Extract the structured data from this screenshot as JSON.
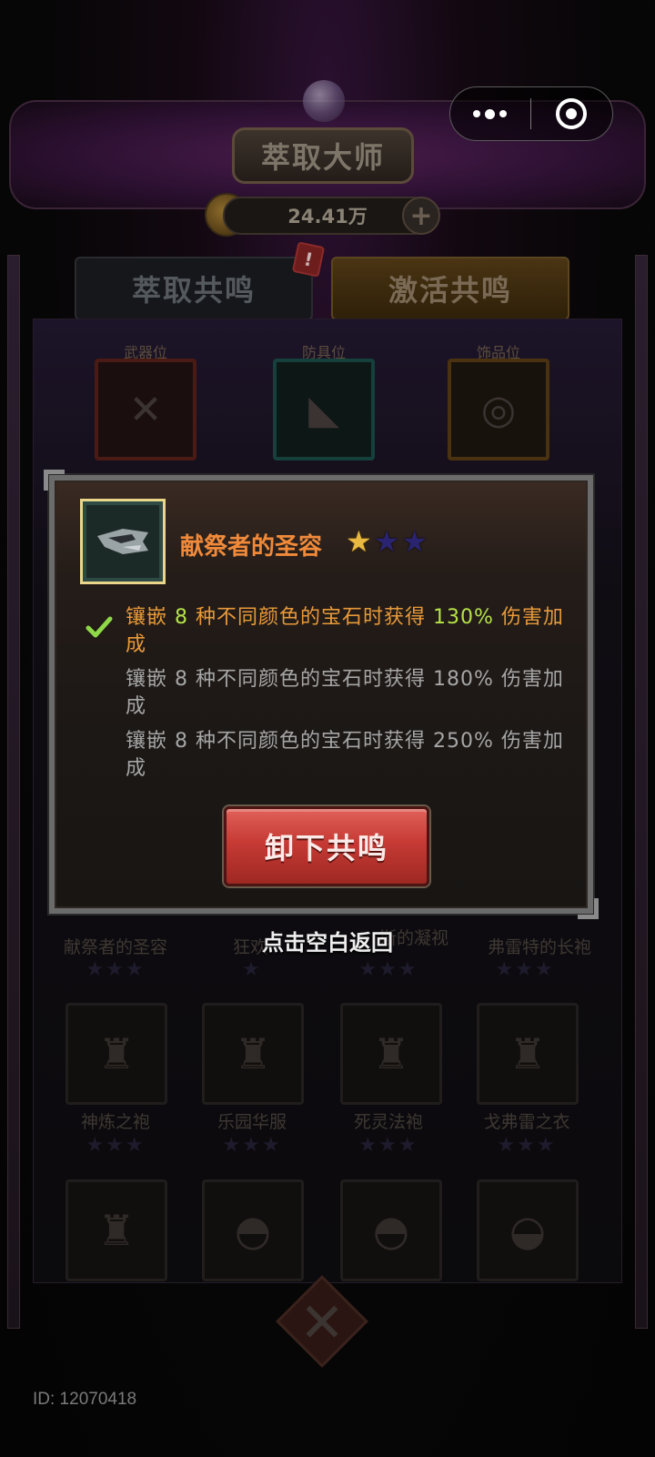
{
  "header": {
    "title": "萃取大师",
    "currency_amount": "24.41万"
  },
  "tabs": [
    {
      "label": "萃取共鸣"
    },
    {
      "label": "激活共鸣"
    }
  ],
  "alert_badge": "!",
  "slots": [
    {
      "label": "武器位"
    },
    {
      "label": "防具位"
    },
    {
      "label": "饰品位"
    }
  ],
  "grid": {
    "row1": [
      {
        "name": "献祭者的圣容"
      },
      {
        "name": "狂欢"
      },
      {
        "name": "斯的凝视"
      },
      {
        "name": "弗雷特的长袍"
      }
    ],
    "row2": [
      {
        "name": "神炼之袍"
      },
      {
        "name": "乐园华服"
      },
      {
        "name": "死灵法袍"
      },
      {
        "name": "戈弗雷之衣"
      }
    ]
  },
  "modal": {
    "item_name": "献祭者的圣容",
    "stars_filled": 1,
    "stars_total": 3,
    "bonuses": [
      {
        "prefix": "镶嵌 ",
        "count": "8",
        "middle": " 种不同颜色的宝石时获得 ",
        "percent": "130%",
        "suffix": " 伤害加成",
        "active": true
      },
      {
        "prefix": "镶嵌 ",
        "count": "8",
        "middle": " 种不同颜色的宝石时获得 ",
        "percent": "180%",
        "suffix": " 伤害加成",
        "active": false
      },
      {
        "prefix": "镶嵌 ",
        "count": "8",
        "middle": " 种不同颜色的宝石时获得 ",
        "percent": "250%",
        "suffix": " 伤害加成",
        "active": false
      }
    ],
    "button_label": "卸下共鸣"
  },
  "tap_hint": "点击空白返回",
  "player_id": "ID: 12070418",
  "colors": {
    "item_name": "#f08a3a",
    "active_bonus": "#e89a3a",
    "highlight_value": "#b6e34a",
    "inactive_bonus": "#a6a6a6",
    "button_red": "#c63a34",
    "star_filled": "#e8b840",
    "star_empty": "#2a2470"
  }
}
